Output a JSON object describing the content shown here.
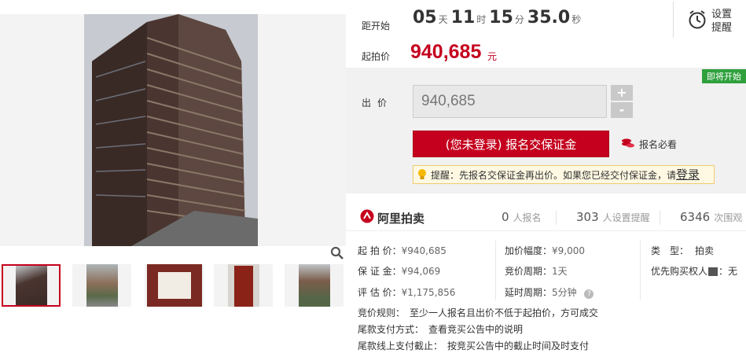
{
  "gallery": {
    "thumbnails": [
      "building-tower",
      "residential-street",
      "notice-paper",
      "red-door",
      "building-side"
    ]
  },
  "countdown": {
    "label": "距开始",
    "days": "05",
    "days_unit": "天",
    "hours": "11",
    "hours_unit": "时",
    "minutes": "15",
    "minutes_unit": "分",
    "seconds": "35.0",
    "seconds_unit": "秒"
  },
  "start_price": {
    "label": "起拍价",
    "value": "940,685",
    "unit": "元"
  },
  "reminder": {
    "label": "设置提醒"
  },
  "status_tag": "即将开始",
  "bid": {
    "label": "出价",
    "value": "940,685",
    "plus": "+",
    "minus": "-",
    "deposit_button": "(您未登录) 报名交保证金",
    "must_read": "报名必看",
    "tip_text": "提醒：先报名交保证金再出价。如果您已经交付保证金，请",
    "tip_login": "登录"
  },
  "stats": {
    "logo": "阿里拍卖",
    "signups": "0",
    "signups_label": "人报名",
    "reminders": "303",
    "reminders_label": "人设置提醒",
    "views": "6346",
    "views_label": "次围观"
  },
  "details": {
    "start_price_k": "起 拍 价：",
    "start_price_v": "¥940,685",
    "deposit_k": "保 证 金：",
    "deposit_v": "¥94,069",
    "assess_k": "评 估 价：",
    "assess_v": "¥1,175,856",
    "increment_k": "加价幅度：",
    "increment_v": "¥9,000",
    "period_k": "竞价周期：",
    "period_v": "1天",
    "delay_k": "延时周期：",
    "delay_v": "5分钟",
    "type_k": "类　型：",
    "type_v": "拍卖",
    "priority_k": "优先购买权人",
    "priority_badge": "■",
    "priority_v": "：无"
  },
  "rules": [
    {
      "k": "竞价规则：",
      "v": "至少一人报名且出价不低于起拍价，方可成交"
    },
    {
      "k": "尾款支付方式：",
      "v": "查看竞买公告中的说明"
    },
    {
      "k": "尾款线上支付截止：",
      "v": "按竞买公告中的截止时间及时支付"
    }
  ],
  "colors": {
    "accent": "#c5001e",
    "tag_green": "#2fa03c",
    "tip_bg": "#fff9e3"
  }
}
